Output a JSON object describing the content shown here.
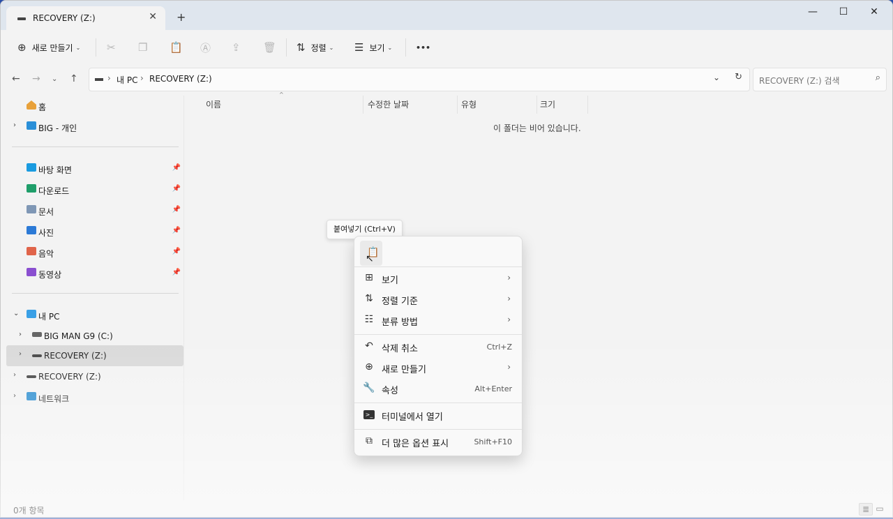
{
  "tab": {
    "title": "RECOVERY (Z:)",
    "close": "✕",
    "new_tab": "+"
  },
  "window_controls": {
    "minimize": "—",
    "maximize": "☐",
    "close": "✕"
  },
  "toolbar": {
    "new_label": "새로 만들기",
    "sort_label": "정렬",
    "view_label": "보기",
    "more": "•••"
  },
  "address": {
    "crumbs": [
      "내 PC",
      "RECOVERY (Z:)"
    ],
    "search_placeholder": "RECOVERY (Z:) 검색"
  },
  "sidebar": {
    "home": "홈",
    "big_personal": "BIG - 개인",
    "desktop": "바탕 화면",
    "downloads": "다운로드",
    "documents": "문서",
    "pictures": "사진",
    "music": "음악",
    "videos": "동영상",
    "this_pc": "내 PC",
    "drive_c": "BIG MAN G9 (C:)",
    "drive_z_child": "RECOVERY (Z:)",
    "drive_z": "RECOVERY (Z:)",
    "network": "네트워크"
  },
  "columns": {
    "name": "이름",
    "modified": "수정한 날짜",
    "type": "유형",
    "size": "크기"
  },
  "empty_message": "이 폴더는 비어 있습니다.",
  "status": {
    "item_count": "0개 항목"
  },
  "tooltip": {
    "paste": "붙여넣기 (Ctrl+V)"
  },
  "context_menu": {
    "view": "보기",
    "sort_by": "정렬 기준",
    "group_by": "분류 방법",
    "undo_delete": "삭제 취소",
    "undo_shortcut": "Ctrl+Z",
    "new": "새로 만들기",
    "properties": "속성",
    "properties_shortcut": "Alt+Enter",
    "open_terminal": "터미널에서 열기",
    "more_options": "더 많은 옵션 표시",
    "more_shortcut": "Shift+F10"
  },
  "colors": {
    "title_bar": "#dfe6ee",
    "window_bg": "#f3f3f3",
    "selection": "#d9d9d9",
    "desktop": "#2a4fa8"
  }
}
